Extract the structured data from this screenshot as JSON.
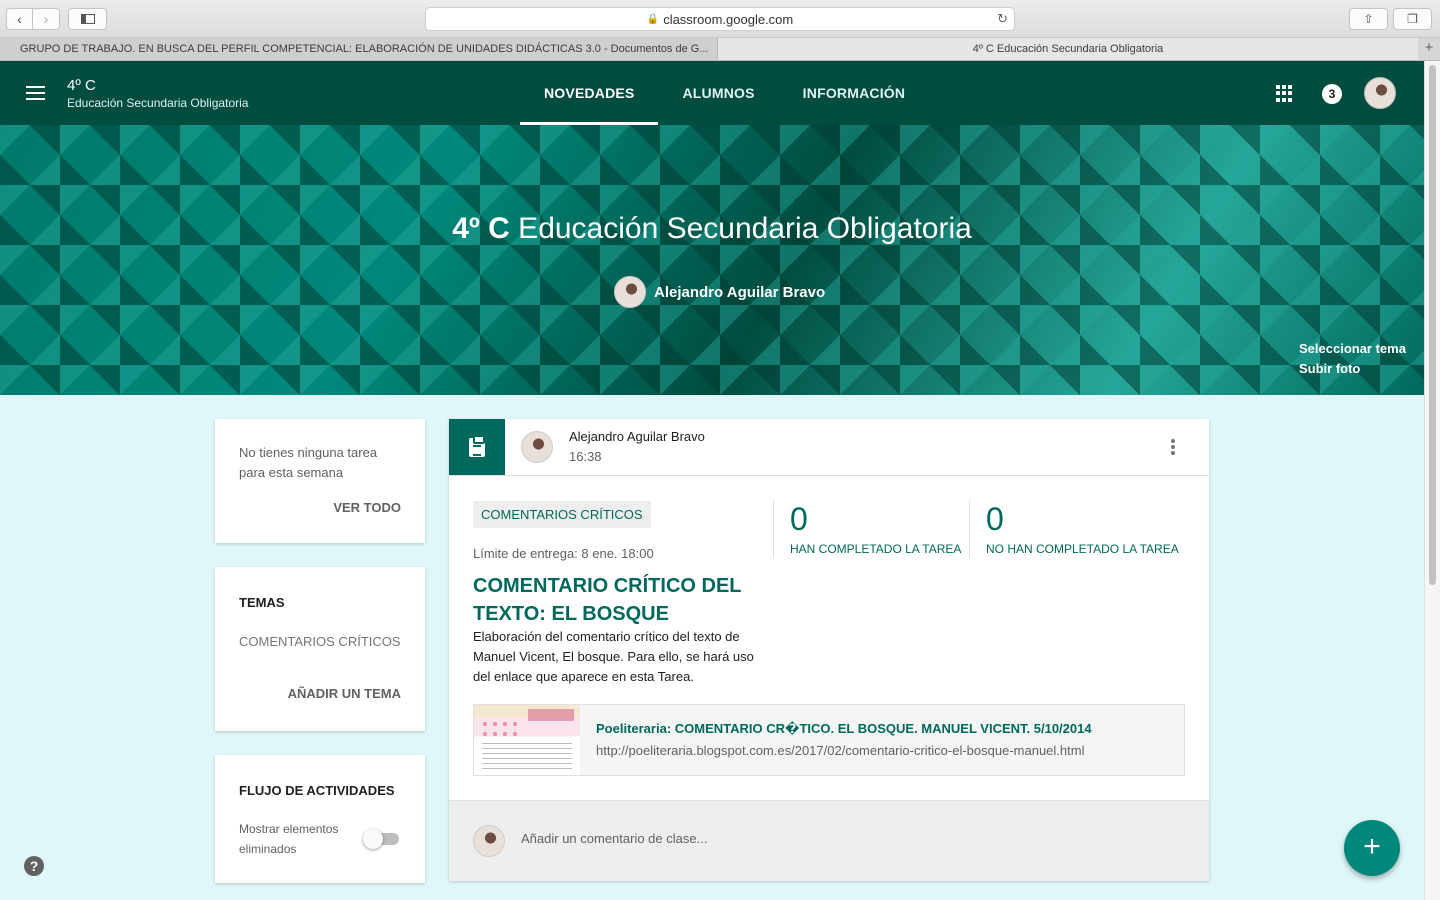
{
  "browser": {
    "url": "classroom.google.com",
    "tabs": [
      {
        "label": "GRUPO DE TRABAJO. EN BUSCA DEL PERFIL COMPETENCIAL: ELABORACIÓN DE UNIDADES DIDÁCTICAS 3.0 - Documentos de G..."
      },
      {
        "label": "4º C Educación Secundaria Obligatoria"
      }
    ],
    "new_tab_symbol": "+"
  },
  "header": {
    "class_name": "4º C",
    "class_section": "Educación Secundaria Obligatoria",
    "tabs": [
      {
        "label": "NOVEDADES",
        "active": true
      },
      {
        "label": "ALUMNOS",
        "active": false
      },
      {
        "label": "INFORMACIÓN",
        "active": false
      }
    ],
    "notifications": "3"
  },
  "banner": {
    "title_bold": "4º C",
    "title_rest": " Educación Secundaria Obligatoria",
    "teacher": "Alejandro Aguilar Bravo",
    "select_theme": "Seleccionar tema",
    "upload_photo": "Subir foto"
  },
  "upcoming": {
    "text": "No tienes ninguna tarea para esta semana",
    "link": "VER TODO"
  },
  "topics": {
    "heading": "TEMAS",
    "items": [
      "COMENTARIOS CRÍTICOS"
    ],
    "add_link": "AÑADIR UN TEMA"
  },
  "stream": {
    "heading": "FLUJO DE ACTIVIDADES",
    "toggle_label": "Mostrar elementos eliminados",
    "toggle_on": false
  },
  "post": {
    "author": "Alejandro Aguilar Bravo",
    "time": "16:38",
    "topic": "COMENTARIOS CRÍTICOS",
    "due": "Límite de entrega: 8 ene. 18:00",
    "title": "COMENTARIO CRÍTICO DEL TEXTO: EL BOSQUE",
    "description": "Elaboración del comentario crítico del texto de Manuel Vicent, El bosque. Para ello, se hará uso del enlace que aparece en esta Tarea.",
    "stats": [
      {
        "value": "0",
        "label": "HAN COMPLETADO LA TAREA"
      },
      {
        "value": "0",
        "label": "NO HAN COMPLETADO LA TAREA"
      }
    ],
    "attachment": {
      "title": "Poeliteraria: COMENTARIO CR�TICO. EL BOSQUE. MANUEL VICENT. 5/10/2014",
      "url": "http://poeliteraria.blogspot.com.es/2017/02/comentario-critico-el-bosque-manuel.html"
    },
    "comment_placeholder": "Añadir un comentario de clase..."
  },
  "help_symbol": "?",
  "fab_symbol": "+",
  "colors": {
    "header": "#004d40",
    "accent": "#00695c",
    "page_bg": "#e0f7fa",
    "fab": "#00897b"
  }
}
